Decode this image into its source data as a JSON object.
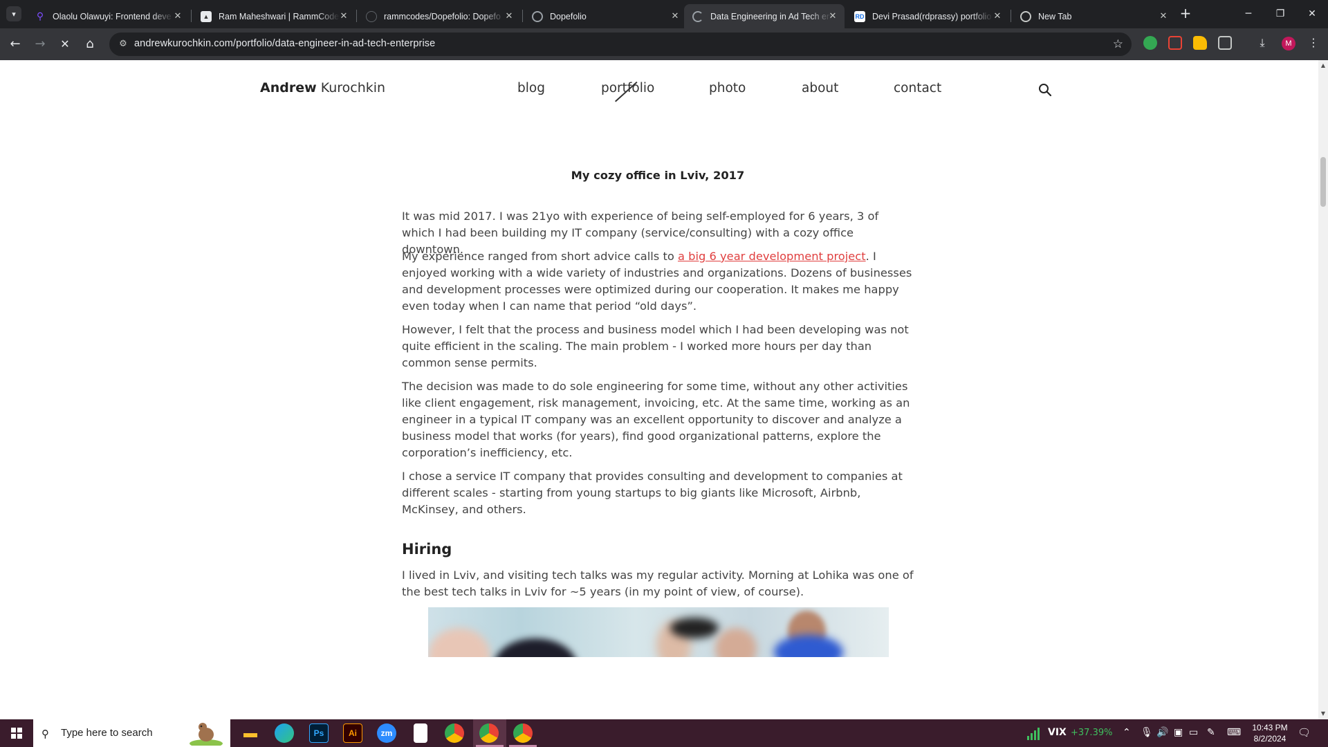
{
  "browser": {
    "tabs": [
      {
        "title": "Olaolu Olawuyi: Frontend deve",
        "favicon_color": "#7c4dff",
        "active": false
      },
      {
        "title": "Ram Maheshwari | RammCode",
        "favicon_color": "#e8eaed",
        "active": false
      },
      {
        "title": "rammcodes/Dopefolio: Dopefo",
        "favicon_color": "#202124",
        "active": false
      },
      {
        "title": "Dopefolio",
        "favicon_color": "#5f6368",
        "active": false
      },
      {
        "title": "Data Engineering in Ad Tech en",
        "favicon_color": "#9aa0a6",
        "active": true
      },
      {
        "title": "Devi Prasad(rdprassy) portfolio",
        "favicon_color": "#1a73e8",
        "active": false
      },
      {
        "title": "New Tab",
        "favicon_color": "#9aa0a6",
        "active": false
      }
    ],
    "url": "andrewkurochkin.com/portfolio/data-engineer-in-ad-tech-enterprise",
    "avatar_letter": "M"
  },
  "site": {
    "logo_bold": "Andrew",
    "logo_regular": "Kurochkin",
    "menu": [
      "blog",
      "portfolio",
      "photo",
      "about",
      "contact"
    ]
  },
  "article": {
    "caption": "My cozy office in Lviv, 2017",
    "p1": "It was mid 2017. I was 21yo with experience of being self-employed for 6 years, 3 of which I had been building my IT company (service/consulting) with a cozy office downtown.",
    "p2_before": "My experience ranged from short advice calls to ",
    "p2_link": "a big 6 year development project",
    "p2_after": ". I enjoyed working with a wide variety of industries and organizations. Dozens of businesses and development processes were optimized during our cooperation. It makes me happy even today when I can name that period “old days”.",
    "p3": "However, I felt that the process and business model which I had been developing was not quite efficient in the scaling. The main problem - I worked more hours per day than common sense permits.",
    "p4": "The decision was made to do sole engineering for some time, without any other activities like client engagement, risk management, invoicing, etc. At the same time, working as an engineer in a typical IT company was an excellent opportunity to discover and analyze a business model that works (for years), find good organizational patterns, explore the corporation’s inefficiency, etc.",
    "p5": "I chose a service IT company that provides consulting and development to companies at different scales - starting from young startups to big giants like Microsoft, Airbnb, McKinsey, and others.",
    "h_hiring": "Hiring",
    "p6": "I lived in Lviv, and visiting tech talks was my regular activity. Morning at Lohika was one of the best tech talks in Lviv for ~5 years (in my point of view, of course)."
  },
  "taskbar": {
    "search_placeholder": "Type here to search",
    "apps": [
      "file-explorer",
      "edge",
      "photoshop",
      "illustrator",
      "zoom",
      "notepad",
      "chrome",
      "chrome-profile-m",
      "chrome-profile-2"
    ],
    "ps_label": "Ps",
    "ai_label": "Ai",
    "zoom_label": "zm",
    "vix_label": "VIX",
    "vix_change": "+37.39%",
    "time": "10:43 PM",
    "date": "8/2/2024"
  },
  "colors": {
    "link": "#e03f3f",
    "tabbar_bg": "#202124",
    "toolbar_bg": "#35363a",
    "taskbar_bg": "#3a1c2c",
    "vix_positive": "#3fbf5e"
  }
}
